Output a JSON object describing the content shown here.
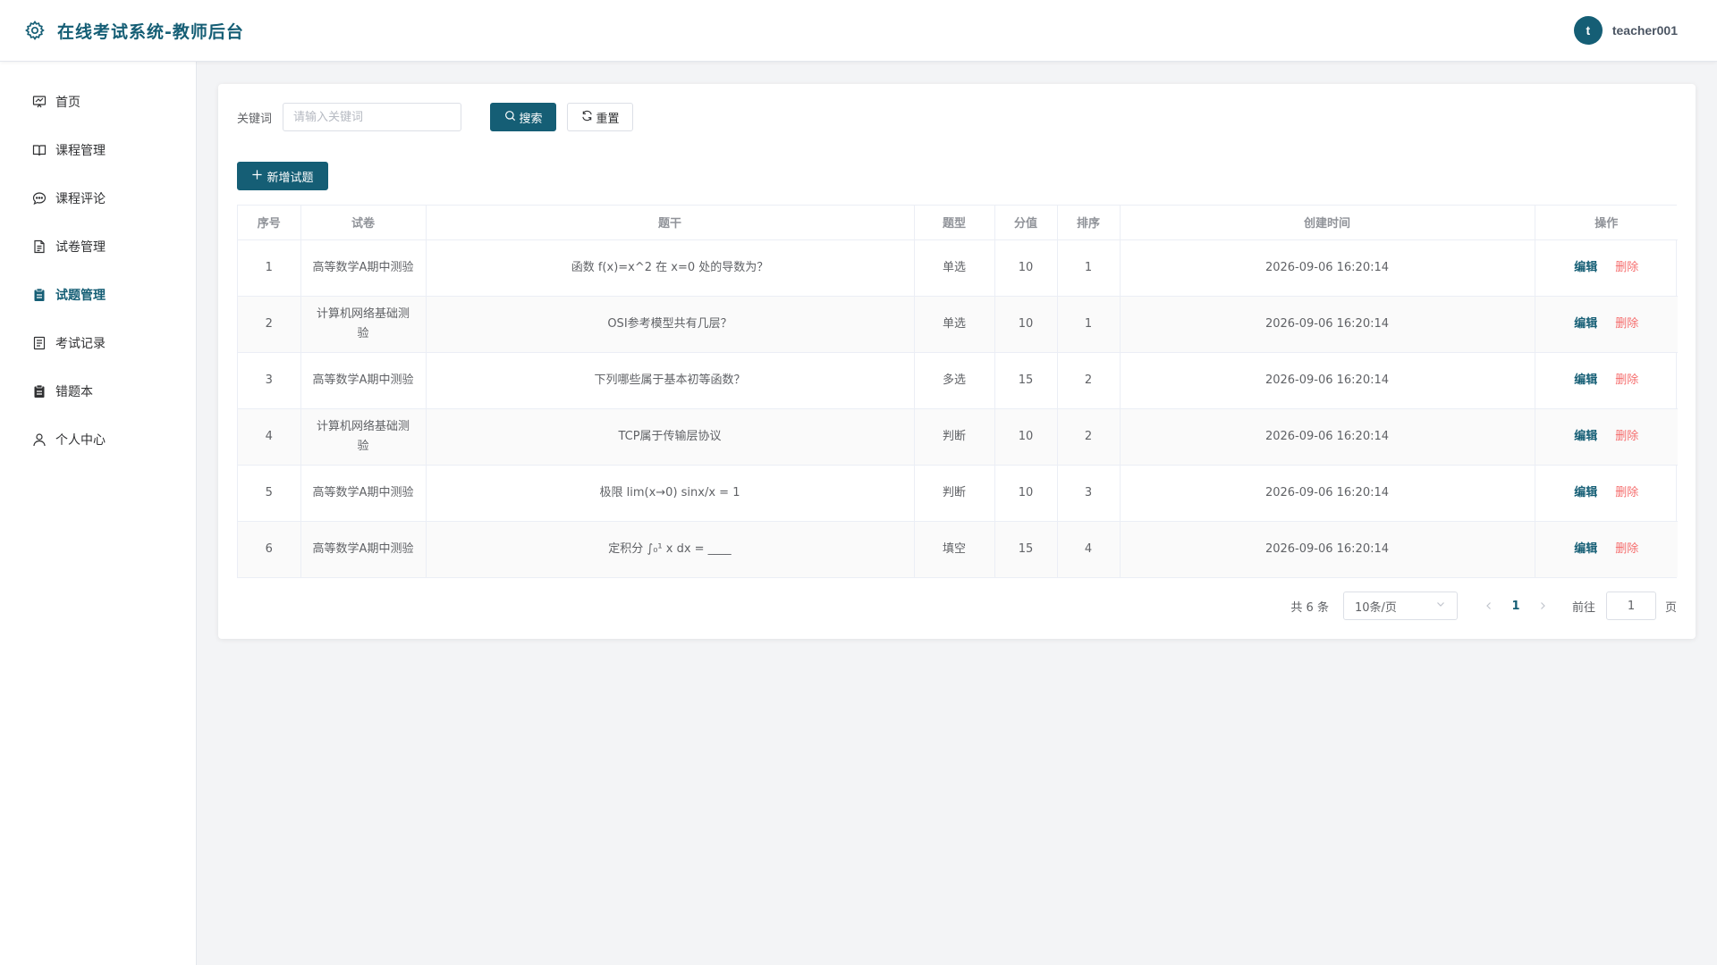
{
  "header": {
    "title": "在线考试系统-教师后台",
    "avatar_letter": "t",
    "username": "teacher001"
  },
  "sidebar": {
    "items": [
      {
        "label": "首页",
        "icon": "dashboard-icon",
        "active": false
      },
      {
        "label": "课程管理",
        "icon": "book-icon",
        "active": false
      },
      {
        "label": "课程评论",
        "icon": "chat-icon",
        "active": false
      },
      {
        "label": "试卷管理",
        "icon": "document-icon",
        "active": false
      },
      {
        "label": "试题管理",
        "icon": "clipboard-icon",
        "active": true
      },
      {
        "label": "考试记录",
        "icon": "record-icon",
        "active": false
      },
      {
        "label": "错题本",
        "icon": "notebook-icon",
        "active": false
      },
      {
        "label": "个人中心",
        "icon": "user-icon",
        "active": false
      }
    ]
  },
  "search": {
    "label": "关键词",
    "placeholder": "请输入关键词",
    "value": "",
    "search_button": "搜索",
    "reset_button": "重置"
  },
  "add_button": "新增试题",
  "table": {
    "columns": [
      "序号",
      "试卷",
      "题干",
      "题型",
      "分值",
      "排序",
      "创建时间",
      "操作"
    ],
    "rows": [
      {
        "no": "1",
        "paper": "高等数学A期中测验",
        "stem": "函数 f(x)=x^2 在 x=0 处的导数为？",
        "type": "单选",
        "score": "10",
        "order": "1",
        "created": "2026-09-06 16:20:14"
      },
      {
        "no": "2",
        "paper": "计算机网络基础测验",
        "stem": "OSI参考模型共有几层？",
        "type": "单选",
        "score": "10",
        "order": "1",
        "created": "2026-09-06 16:20:14"
      },
      {
        "no": "3",
        "paper": "高等数学A期中测验",
        "stem": "下列哪些属于基本初等函数？",
        "type": "多选",
        "score": "15",
        "order": "2",
        "created": "2026-09-06 16:20:14"
      },
      {
        "no": "4",
        "paper": "计算机网络基础测验",
        "stem": "TCP属于传输层协议",
        "type": "判断",
        "score": "10",
        "order": "2",
        "created": "2026-09-06 16:20:14"
      },
      {
        "no": "5",
        "paper": "高等数学A期中测验",
        "stem": "极限 lim(x→0) sinx/x = 1",
        "type": "判断",
        "score": "10",
        "order": "3",
        "created": "2026-09-06 16:20:14"
      },
      {
        "no": "6",
        "paper": "高等数学A期中测验",
        "stem": "定积分 ∫₀¹ x dx = ____",
        "type": "填空",
        "score": "15",
        "order": "4",
        "created": "2026-09-06 16:20:14"
      }
    ],
    "edit_label": "编辑",
    "delete_label": "删除"
  },
  "pagination": {
    "total": "共 6 条",
    "page_size": "10条/页",
    "current_page": "1",
    "goto_label": "前往",
    "goto_value": "1",
    "page_suffix": "页"
  },
  "colors": {
    "primary": "#155e75",
    "danger": "#f56c6c",
    "background": "#f3f4f6"
  }
}
